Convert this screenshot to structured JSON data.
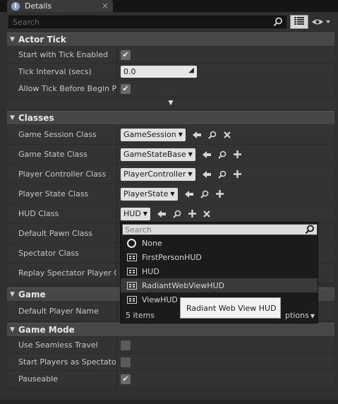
{
  "tab": {
    "icon": "info-icon",
    "title": "Details"
  },
  "toolbar": {
    "search_placeholder": "Search"
  },
  "sections": {
    "actor_tick": {
      "title": "Actor Tick",
      "start_with_tick_label": "Start with Tick Enabled",
      "start_with_tick_checked": true,
      "tick_interval_label": "Tick Interval (secs)",
      "tick_interval_value": "0.0",
      "allow_tick_label": "Allow Tick Before Begin Pla",
      "allow_tick_checked": true
    },
    "classes": {
      "title": "Classes",
      "game_session_label": "Game Session Class",
      "game_session_value": "GameSession",
      "game_state_label": "Game State Class",
      "game_state_value": "GameStateBase",
      "player_controller_label": "Player Controller Class",
      "player_controller_value": "PlayerController",
      "player_state_label": "Player State Class",
      "player_state_value": "PlayerState",
      "hud_label": "HUD Class",
      "hud_value": "HUD",
      "default_pawn_label": "Default Pawn Class",
      "spectator_label": "Spectator Class",
      "replay_spectator_label": "Replay Spectator Player Co"
    },
    "game": {
      "title": "Game",
      "default_player_name_label": "Default Player Name"
    },
    "game_mode": {
      "title": "Game Mode",
      "seamless_label": "Use Seamless Travel",
      "seamless_checked": false,
      "spectators_label": "Start Players as Spectators",
      "spectators_checked": false,
      "pauseable_label": "Pauseable",
      "pauseable_checked": true
    }
  },
  "dropdown": {
    "search_placeholder": "Search",
    "items": [
      "None",
      "FirstPersonHUD",
      "HUD",
      "RadiantWebViewHUD",
      "ViewHUD"
    ],
    "highlighted_index": 3,
    "count_label": "5 items",
    "view_options_label": "ptions"
  },
  "tooltip": {
    "text": "Radiant Web View HUD"
  },
  "glyphs": {
    "check": "✔",
    "close": "×",
    "tri_down": "▼",
    "expand": "▼"
  }
}
